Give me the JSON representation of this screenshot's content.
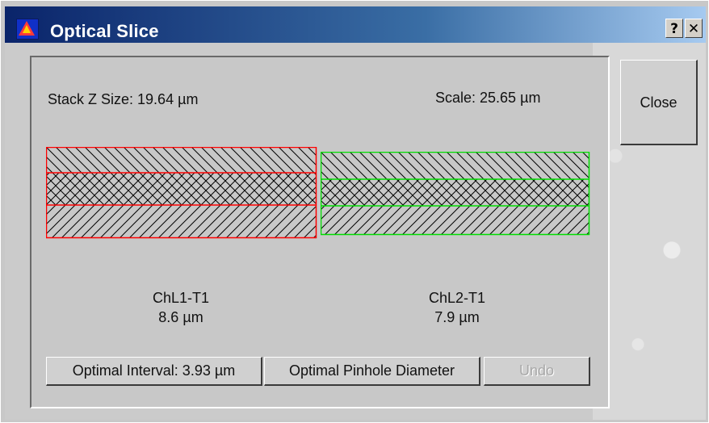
{
  "window": {
    "title": "Optical Slice",
    "help_button": "?",
    "close_x": "✕"
  },
  "info": {
    "stack_z_size": "Stack Z Size:   19.64 µm",
    "scale": "Scale:   25.65 µm"
  },
  "channels": [
    {
      "name": "ChL1-T1",
      "thickness": "8.6 µm",
      "color": "#ff0000"
    },
    {
      "name": "ChL2-T1",
      "thickness": "7.9 µm",
      "color": "#00dd00"
    }
  ],
  "buttons": {
    "optimal_interval": "Optimal Interval: 3.93 µm",
    "optimal_pinhole": "Optimal Pinhole Diameter",
    "undo": "Undo",
    "close": "Close"
  },
  "colors": {
    "titlebar_start": "#0a246a",
    "titlebar_end": "#a6caf0"
  }
}
